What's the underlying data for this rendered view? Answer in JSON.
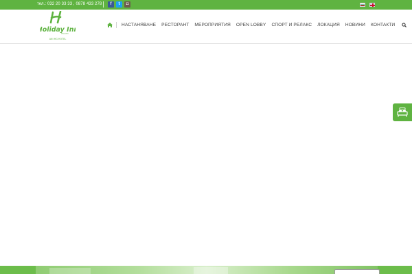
{
  "topbar": {
    "phone": "тел.: 032 20 33 33 , 0878 433 278",
    "social": [
      {
        "icon": "facebook-icon",
        "glyph": "f"
      },
      {
        "icon": "twitter-icon",
        "glyph": "t"
      },
      {
        "icon": "instagram-icon",
        "glyph": "◘"
      }
    ],
    "languages": [
      "bg-flag-icon",
      "en-flag-icon"
    ]
  },
  "logo": {
    "brand": "Holiday Inn",
    "sub": "Plovdiv",
    "tag": "AN IHG HOTEL"
  },
  "nav": {
    "items": [
      "НАСТАНЯВАНЕ",
      "РЕСТОРАНТ",
      "МЕРОПРИЯТИЯ",
      "OPEN LOBBY",
      "СПОРТ И РЕЛАКС",
      "ЛОКАЦИЯ",
      "НОВИНИ",
      "КОНТАКТИ"
    ]
  },
  "colors": {
    "brand_green": "#5fb341",
    "nav_text": "#3d3d3d"
  },
  "booking": {
    "icon": "hotel-bed-icon"
  }
}
